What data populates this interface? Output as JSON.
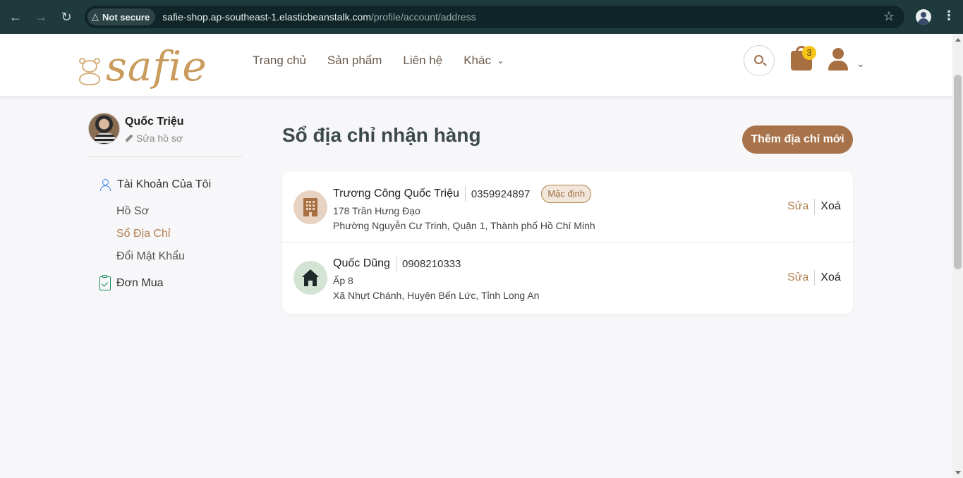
{
  "browser": {
    "security_label": "Not secure",
    "url_host": "safie-shop.ap-southeast-1.elasticbeanstalk.com",
    "url_path": "/profile/account/address"
  },
  "header": {
    "logo_text": "safie",
    "nav": [
      {
        "label": "Trang chủ"
      },
      {
        "label": "Sản phẩm"
      },
      {
        "label": "Liên hệ"
      },
      {
        "label": "Khác"
      }
    ],
    "cart_count": "3"
  },
  "sidebar": {
    "user_name": "Quốc Triệu",
    "edit_profile": "Sửa hồ sơ",
    "account_group": "Tài Khoản Của Tôi",
    "items": [
      {
        "label": "Hồ Sơ"
      },
      {
        "label": "Sổ Địa Chỉ"
      },
      {
        "label": "Đổi Mật Khẩu"
      }
    ],
    "orders_group": "Đơn Mua"
  },
  "main": {
    "title": "Sổ địa chỉ nhận hàng",
    "add_button": "Thêm địa chỉ mới",
    "addresses": [
      {
        "name": "Trương Công Quốc Triệu",
        "phone": "0359924897",
        "badge": "Mặc định",
        "line1": "178 Trần Hưng Đạo",
        "line2": "Phường Nguyễn Cư Trinh, Quận 1, Thành phố Hồ Chí Minh",
        "icon": "building-icon",
        "edit": "Sửa",
        "delete": "Xoá"
      },
      {
        "name": "Quốc Dũng",
        "phone": "0908210333",
        "line1": "Ấp 8",
        "line2": "Xã Nhựt Chánh, Huyện Bến Lức, Tỉnh Long An",
        "icon": "house-icon",
        "edit": "Sửa",
        "delete": "Xoá"
      }
    ]
  },
  "colors": {
    "brand": "#a8734a",
    "active_link": "#b0804f",
    "chrome_bg": "#1f3a3c"
  }
}
